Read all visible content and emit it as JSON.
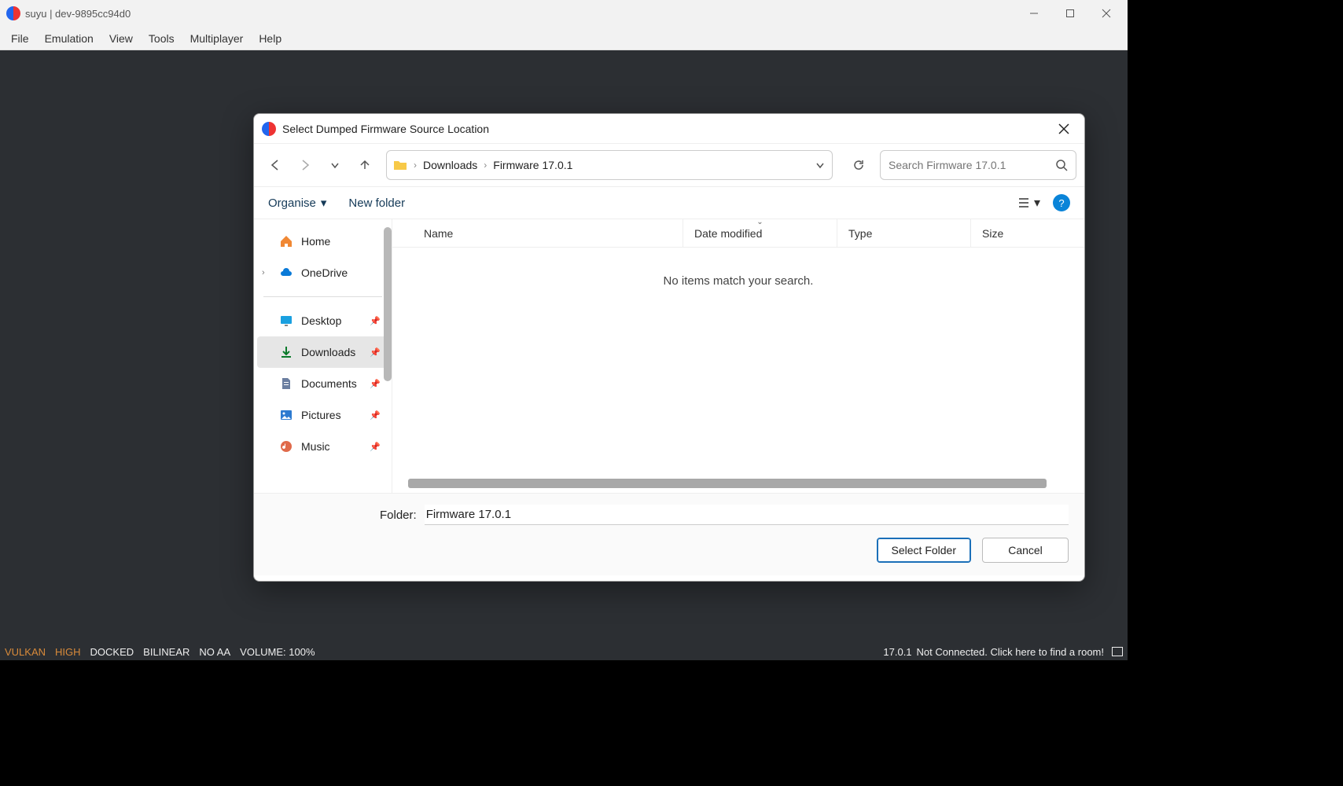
{
  "app": {
    "title": "suyu | dev-9895cc94d0"
  },
  "menus": [
    "File",
    "Emulation",
    "View",
    "Tools",
    "Multiplayer",
    "Help"
  ],
  "status": {
    "vulkan": "VULKAN",
    "high": "HIGH",
    "docked": "DOCKED",
    "bilinear": "BILINEAR",
    "noaa": "NO AA",
    "volume": "VOLUME: 100%",
    "version": "17.0.1",
    "conn": "Not Connected. Click here to find a room!"
  },
  "dialog": {
    "title": "Select Dumped Firmware Source Location",
    "breadcrumbs": [
      "Downloads",
      "Firmware 17.0.1"
    ],
    "search_placeholder": "Search Firmware 17.0.1",
    "organise": "Organise",
    "newfolder": "New folder",
    "columns": {
      "name": "Name",
      "date": "Date modified",
      "type": "Type",
      "size": "Size"
    },
    "empty": "No items match your search.",
    "folder_label": "Folder:",
    "folder_value": "Firmware 17.0.1",
    "select_btn": "Select Folder",
    "cancel_btn": "Cancel",
    "sidebar": {
      "home": "Home",
      "onedrive": "OneDrive",
      "desktop": "Desktop",
      "downloads": "Downloads",
      "documents": "Documents",
      "pictures": "Pictures",
      "music": "Music"
    }
  }
}
